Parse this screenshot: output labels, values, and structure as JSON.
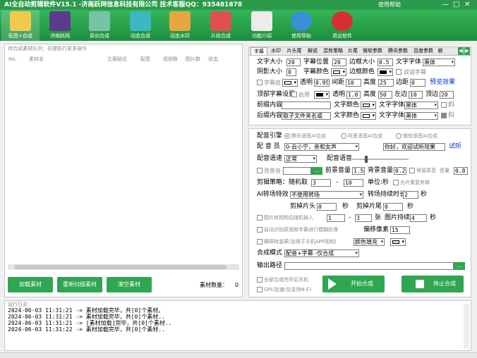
{
  "titlebar": {
    "title": "AI全自动剪辑软件V15.1 -济南跃网信息科技有限公司 技术客服QQ：935481878",
    "help": "使用帮助",
    "min": "—",
    "max": "□",
    "close": "✕"
  },
  "toolbar": [
    {
      "label": "配音+合成",
      "icon": "merge-icon",
      "color": "#f2c94c"
    },
    {
      "label": "济南跃网",
      "icon": "camera-icon",
      "color": "#5a3c8c"
    },
    {
      "label": "原创合成",
      "icon": "image-icon",
      "color": "#78c3a8"
    },
    {
      "label": "动态合成",
      "icon": "film-icon",
      "color": "#3cb7c4"
    },
    {
      "label": "动态水印",
      "icon": "watermark-icon",
      "color": "#e8a640"
    },
    {
      "label": "片段合成",
      "icon": "clip-icon",
      "color": "#e05050"
    },
    {
      "label": "功能介绍",
      "icon": "home-icon",
      "color": "#ececec"
    },
    {
      "label": "使用帮助",
      "icon": "help-icon",
      "color": "#3a8fd8"
    },
    {
      "label": "退出软件",
      "icon": "exit-icon",
      "color": "#d83030"
    }
  ],
  "queue": {
    "title": "待合成素材队列：右键执行更多操作",
    "columns": [
      "No.",
      "素材名",
      "文案路径",
      "配音",
      "视频数",
      "图片数",
      "状态"
    ],
    "load_btn": "加载素材",
    "rescan_btn": "重新扫描素材",
    "clear_btn": "清空素材",
    "count_label": "素材数量：",
    "count": "0"
  },
  "tabs": [
    "字幕",
    "水印",
    "片头尾",
    "解说",
    "混剪策略",
    "片尾",
    "微软参数",
    "腾讯参数",
    "百度参数",
    "剧"
  ],
  "subtitle": {
    "font_size_label": "文字大小",
    "font_size": "20",
    "sub_pos_label": "字幕位置",
    "sub_pos": "20",
    "border_size_label": "边框大小",
    "border_size": "0.5",
    "font_label": "文字字体",
    "font": "黑体",
    "shadow_label": "阴影大小",
    "shadow": "0",
    "sub_color_label": "字幕颜色",
    "border_color_label": "边框颜色",
    "double_sub_label": "双语字幕",
    "sub_bg_label": "字幕底",
    "alpha_label": "透明",
    "alpha": "0.95",
    "spacing_label": "间距",
    "spacing": "10",
    "height_label": "高度",
    "height": "25",
    "margin_label": "边距",
    "margin": "0",
    "preview": "预览效果",
    "top_sub_label": "顶部字幕设置",
    "enable_label": "启用",
    "top_alpha_label": "透明",
    "top_alpha": "1.0",
    "top_height_label": "高度",
    "top_height": "50",
    "left_label": "左边",
    "left": "10",
    "top_margin_label": "顶边",
    "top_margin": "20",
    "front_label": "前缀内容",
    "front": "",
    "text_color_label": "文字颜色",
    "text_font_label": "文字字体",
    "text_font": "黑体",
    "bold_label": "斜",
    "back_label": "后缀内容",
    "back": "取子文件夹名或",
    "text_color_label2": "文字颜色",
    "text_font_label2": "文字字体",
    "text_font2": "黑体",
    "bold_label2": "斜"
  },
  "dub": {
    "engine_label": "配音引擎",
    "engines": [
      "腾讯语音AI合成",
      "阿里语音AI合成",
      "微软语音AI合成"
    ],
    "voice_label": "配 音 员",
    "voice": "0-云小宁，亲和女声",
    "sample_text": "你好，欢迎试听效果",
    "try_label": "试听",
    "speed_label": "配音语速",
    "speed": "正常",
    "vol_label": "配音语音",
    "bgm_label": "背景音",
    "front_vol_label": "前景音量",
    "front_vol": "1.5",
    "back_vol_label": "背景音量",
    "back_vol": "0.2",
    "keep_label": "保留原音",
    "vol2_label": "音量",
    "vol2": "0.8",
    "cut_label": "剪辑策略：随机取",
    "cut_from": "3",
    "cut_dash": "-",
    "cut_to": "10",
    "unit_label": "单位:秒",
    "allow_repeat": "允许重复剪辑",
    "trans_label": "AI转场特效",
    "trans": "不使用转场",
    "trans_dur_label": "转场持续时长",
    "trans_dur": "2",
    "sec1": "秒",
    "cut_head_label": "剪掉片头",
    "cut_head": "0",
    "sec2": "秒",
    "cut_tail_label": "剪掉片尾",
    "cut_tail": "0",
    "sec3": "秒",
    "img_insert_label": "图片转视频后随机插入",
    "img_from": "1",
    "img_dash": "-",
    "img_to": "3",
    "img_unit": "张",
    "img_dur_label": "图片持续",
    "img_dur": "4",
    "sec4": "秒",
    "auto_blur_label": "自动识别原视频字幕进行模糊处理",
    "offset_label": "偏移像素",
    "offset": "15",
    "landscape_label": "横屏转竖屏(适用于手机APP视频)",
    "fill_label": "颜色填充",
    "mode_label": "合成模式",
    "mode": "配音+字幕 -仅合成",
    "out_label": "输出路径",
    "out": "",
    "shutdown_label": "全部合成完毕后关机",
    "gpu_label": "GPU加速(仅支持N卡)",
    "start_btn": "开始合成",
    "stop_btn": "停止合成"
  },
  "log": {
    "title": "运行日志：",
    "lines": [
      "2024-06-03 11:31:21 -> 素材加载完毕，共[0]个素材。",
      "2024-06-03 11:31:21 -> 素材加载完毕，共[0]个素材..",
      "2024-06-03 11:31:21 -> [素材加载]完毕，共[0]个素材..",
      "2024-06-03 11:31:22 -> 素材加载完毕，共[0]个素材.."
    ]
  }
}
